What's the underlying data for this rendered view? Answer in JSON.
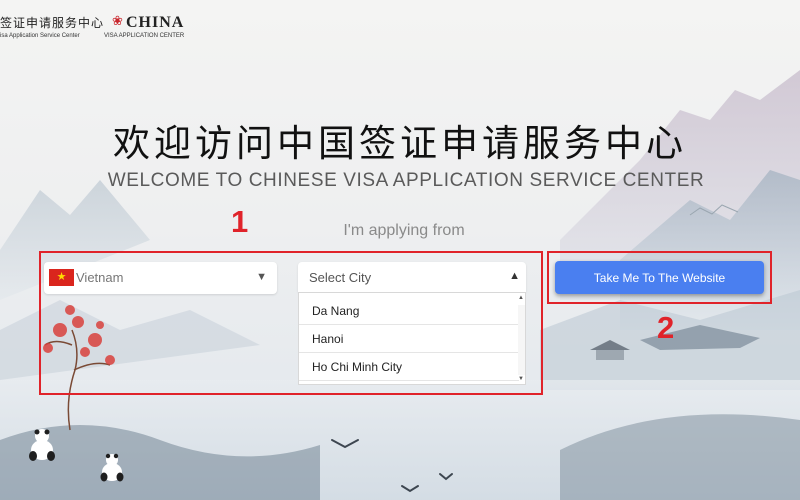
{
  "header": {
    "logo_vac_cn": "签证申请服务中心",
    "logo_vac_en": "isa Application Service Center",
    "logo_china_word": "CHINA",
    "logo_china_sub": "VISA APPLICATION CENTER"
  },
  "hero": {
    "title_cn": "欢迎访问中国签证申请服务中心",
    "title_en": "WELCOME TO CHINESE VISA APPLICATION SERVICE CENTER"
  },
  "form": {
    "applying_from_label": "I'm applying from",
    "country_selected": "Vietnam",
    "country_flag_icon": "vietnam-flag-icon",
    "city_placeholder": "Select City",
    "city_options": [
      "Da Nang",
      "Hanoi",
      "Ho Chi Minh City"
    ],
    "submit_label": "Take Me To The Website"
  },
  "annotations": {
    "label_1": "1",
    "label_2": "2",
    "color": "#e0232a"
  },
  "colors": {
    "button": "#4a7ff0",
    "flag_red": "#da251d",
    "flag_star": "#ffdd00"
  }
}
